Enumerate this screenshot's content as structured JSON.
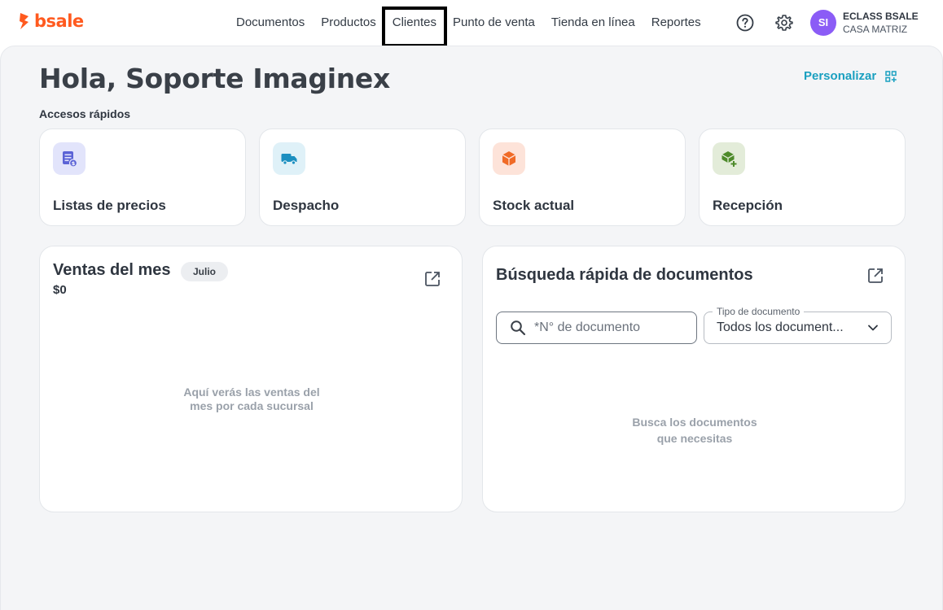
{
  "brand": {
    "name": "bsale",
    "color": "#ff5a1f"
  },
  "nav": {
    "items": [
      {
        "label": "Documentos"
      },
      {
        "label": "Productos"
      },
      {
        "label": "Clientes"
      },
      {
        "label": "Punto de venta"
      },
      {
        "label": "Tienda en línea"
      },
      {
        "label": "Reportes"
      }
    ]
  },
  "account": {
    "initials": "SI",
    "name": "ECLASS BSALE",
    "branch": "CASA MATRIZ",
    "avatar_color": "#8b5cf6"
  },
  "header": {
    "greeting": "Hola, Soporte Imaginex",
    "customize_label": "Personalizar"
  },
  "quick_access": {
    "title": "Accesos rápidos",
    "items": [
      {
        "label": "Listas de precios",
        "icon": "price-list-icon"
      },
      {
        "label": "Despacho",
        "icon": "truck-icon"
      },
      {
        "label": "Stock actual",
        "icon": "box-icon"
      },
      {
        "label": "Recepción",
        "icon": "box-add-icon"
      }
    ]
  },
  "sales": {
    "title": "Ventas del mes",
    "month": "Julio",
    "amount": "$0",
    "empty_line1": "Aquí verás las ventas del",
    "empty_line2": "mes por cada sucursal"
  },
  "doc_search": {
    "title": "Búsqueda rápida de documentos",
    "placeholder": "*N° de documento",
    "type_label": "Tipo de documento",
    "type_value": "Todos los document...",
    "empty_line1": "Busca los documentos",
    "empty_line2": "que necesitas"
  },
  "colors": {
    "accent": "#1aa0c0",
    "background": "#f4f5f7"
  }
}
